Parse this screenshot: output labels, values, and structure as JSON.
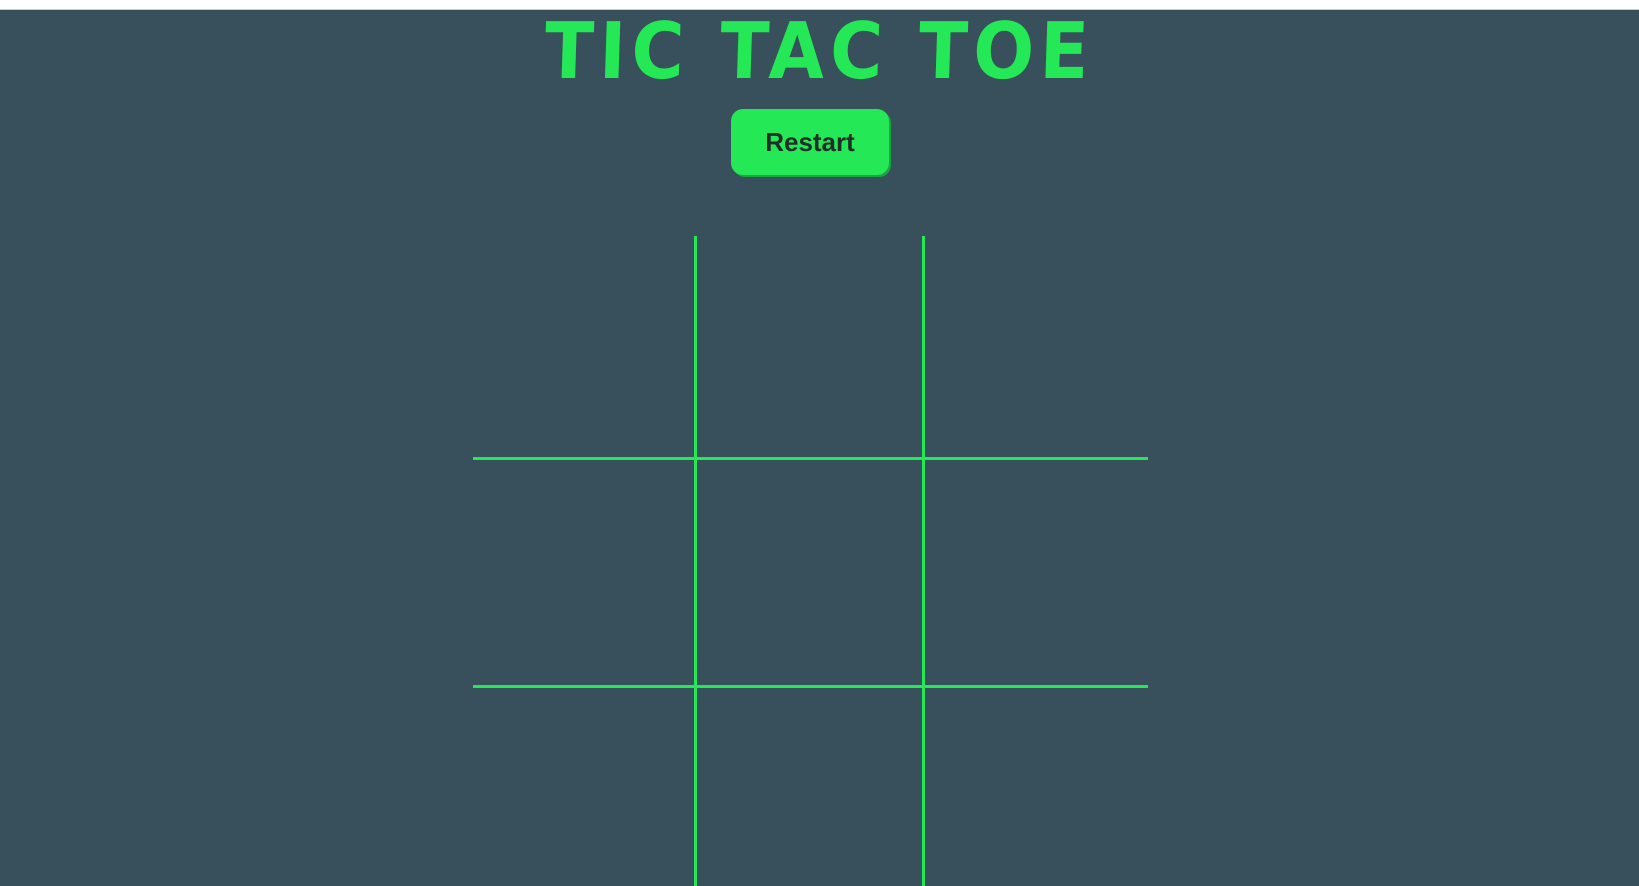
{
  "header": {
    "title": "TIC TAC TOE",
    "restart_label": "Restart"
  },
  "board": {
    "cells": [
      "",
      "",
      "",
      "",
      "",
      "",
      "",
      "",
      ""
    ]
  },
  "colors": {
    "background": "#38505c",
    "accent": "#24e855",
    "button_text": "#1e2e28"
  }
}
